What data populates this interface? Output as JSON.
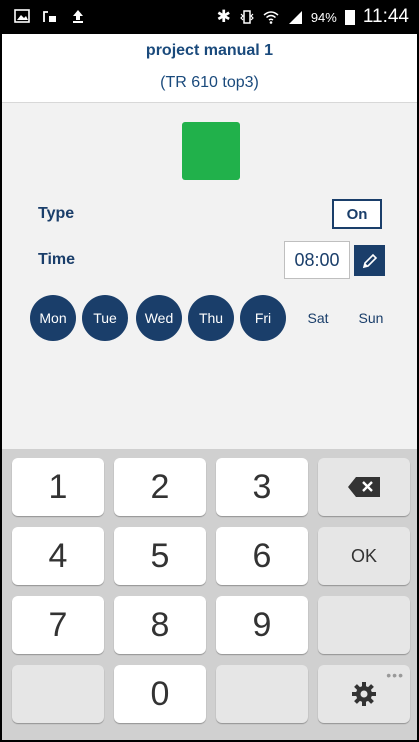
{
  "status_bar": {
    "left_icons": [
      "image-icon",
      "screenshot-icon",
      "upload-icon"
    ],
    "right_icons": [
      "bluetooth-icon",
      "vibrate-icon",
      "wifi-icon",
      "signal-icon"
    ],
    "battery_pct": "94%",
    "time": "11:44"
  },
  "header": {
    "title": "project manual 1",
    "subtitle": "(TR 610 top3)"
  },
  "swatch_color": "#21b14b",
  "type_row": {
    "label": "Type",
    "value": "On"
  },
  "time_row": {
    "label": "Time",
    "value": "08:00"
  },
  "days": [
    {
      "label": "Mon",
      "active": true
    },
    {
      "label": "Tue",
      "active": true
    },
    {
      "label": "Wed",
      "active": true
    },
    {
      "label": "Thu",
      "active": true
    },
    {
      "label": "Fri",
      "active": true
    },
    {
      "label": "Sat",
      "active": false
    },
    {
      "label": "Sun",
      "active": false
    }
  ],
  "keypad": {
    "keys": [
      "1",
      "2",
      "3",
      "4",
      "5",
      "6",
      "7",
      "8",
      "9",
      "0"
    ],
    "ok_label": "OK",
    "settings_dots": "•••"
  },
  "colors": {
    "accent": "#1a3e6a",
    "status_bar": "#000000",
    "active_day": "#1a3e6a",
    "keypad_bg": "#d0d0d0"
  }
}
